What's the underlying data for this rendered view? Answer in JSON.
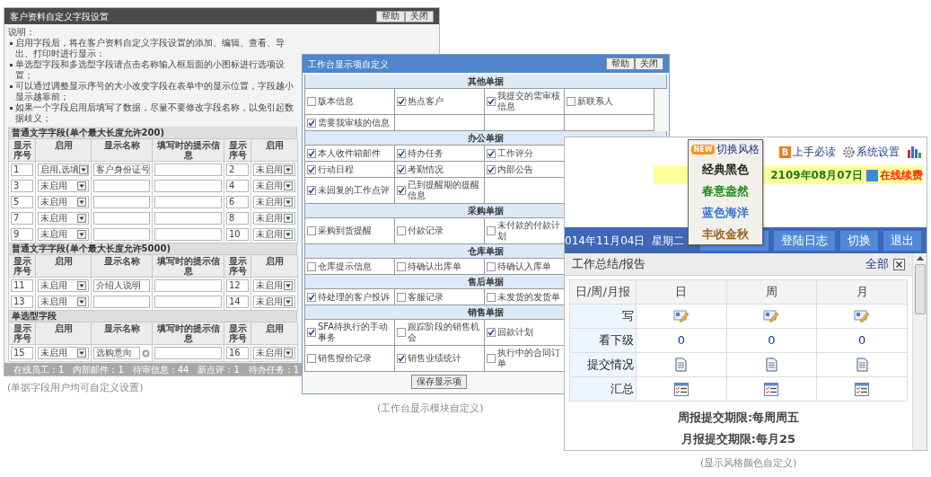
{
  "field_settings_window": {
    "title": "客户资料自定义字段设置",
    "buttons": [
      "帮助",
      "关闭"
    ],
    "notes_label": "说明：",
    "notes": [
      "启用字段后，将在客户资料自定义字段设置的添加、编辑、查看、导出、打印时进行显示：",
      "单选型字段和多选型字段请点击名称输入框后面的小图标进行选项设置；",
      "可以通过调整显示序号的大小改变字段在表单中的显示位置，字段越小显示越靠前；",
      "如果一个字段启用后填写了数据，尽量不要修改字段名称，以免引起数据歧义；"
    ],
    "sections": [
      {
        "title": "普通文字字段(单个最大长度允许200)",
        "columns": [
          "显示序号",
          "启用",
          "显示名称",
          "填写时的提示信息",
          "显示序号",
          "启用"
        ],
        "rows": [
          [
            {
              "kind": "number",
              "value": "1"
            },
            {
              "kind": "select",
              "value": "启用,选填"
            },
            {
              "kind": "text",
              "value": "客户身份证号"
            },
            {
              "kind": "text"
            },
            {
              "kind": "number",
              "value": "2"
            },
            {
              "kind": "select",
              "value": "未启用"
            }
          ],
          [
            {
              "kind": "number",
              "value": "3"
            },
            {
              "kind": "select",
              "value": "未启用"
            },
            {
              "kind": "text"
            },
            {
              "kind": "text"
            },
            {
              "kind": "number",
              "value": "4"
            },
            {
              "kind": "select",
              "value": "未启用"
            }
          ],
          [
            {
              "kind": "number",
              "value": "5"
            },
            {
              "kind": "select",
              "value": "未启用"
            },
            {
              "kind": "text"
            },
            {
              "kind": "text"
            },
            {
              "kind": "number",
              "value": "6"
            },
            {
              "kind": "select",
              "value": "未启用"
            }
          ],
          [
            {
              "kind": "number",
              "value": "7"
            },
            {
              "kind": "select",
              "value": "未启用"
            },
            {
              "kind": "text"
            },
            {
              "kind": "text"
            },
            {
              "kind": "number",
              "value": "8"
            },
            {
              "kind": "select",
              "value": "未启用"
            }
          ],
          [
            {
              "kind": "number",
              "value": "9"
            },
            {
              "kind": "select",
              "value": "未启用"
            },
            {
              "kind": "text"
            },
            {
              "kind": "text"
            },
            {
              "kind": "number",
              "value": "10"
            },
            {
              "kind": "select",
              "value": "未启用"
            }
          ]
        ]
      },
      {
        "title": "普通文字字段(单个最大长度允许5000)",
        "columns": [
          "显示序号",
          "启用",
          "显示名称",
          "填写时的提示信息",
          "显示序号",
          "启用"
        ],
        "rows": [
          [
            {
              "kind": "number",
              "value": "11"
            },
            {
              "kind": "select",
              "value": "未启用"
            },
            {
              "kind": "text",
              "value": "介绍人说明"
            },
            {
              "kind": "text"
            },
            {
              "kind": "number",
              "value": "12"
            },
            {
              "kind": "select",
              "value": "未启用"
            }
          ],
          [
            {
              "kind": "number",
              "value": "13"
            },
            {
              "kind": "select",
              "value": "未启用"
            },
            {
              "kind": "text"
            },
            {
              "kind": "text"
            },
            {
              "kind": "number",
              "value": "14"
            },
            {
              "kind": "select",
              "value": "未启用"
            }
          ]
        ]
      },
      {
        "title": "单选型字段",
        "columns": [
          "显示序号",
          "启用",
          "显示名称",
          "填写时的提示信息",
          "显示序号",
          "启用"
        ],
        "rows": [
          [
            {
              "kind": "number",
              "value": "15"
            },
            {
              "kind": "select",
              "value": "未启用"
            },
            {
              "kind": "options",
              "value": "选购意向"
            },
            {
              "kind": "text"
            },
            {
              "kind": "number",
              "value": "16"
            },
            {
              "kind": "select",
              "value": "未启用"
            }
          ]
        ]
      }
    ],
    "status_bar": [
      "在线员工：1",
      "内部邮件：1",
      "待审信息：44",
      "新点评：1",
      "待办任务：1"
    ],
    "caption": "(单据字段用户均可自定义设置)"
  },
  "workbench_window": {
    "title": "工作台显示项自定义",
    "buttons": [
      "帮助",
      "关闭"
    ],
    "groups": [
      {
        "title": "其他单据",
        "rows": [
          [
            {
              "label": "版本信息",
              "checked": false
            },
            {
              "label": "热点客户",
              "checked": true
            },
            {
              "label": "我提交的需审核信息",
              "checked": true
            },
            {
              "label": "新联系人",
              "checked": false
            }
          ],
          [
            {
              "label": "需要我审核的信息",
              "checked": true
            }
          ]
        ]
      },
      {
        "title": "办公单据",
        "rows": [
          [
            {
              "label": "本人收件箱邮件",
              "checked": true
            },
            {
              "label": "待办任务",
              "checked": true
            },
            {
              "label": "工作评分",
              "checked": true
            }
          ],
          [
            {
              "label": "行动日程",
              "checked": true
            },
            {
              "label": "考勤情况",
              "checked": true
            },
            {
              "label": "内部公告",
              "checked": true
            }
          ],
          [
            {
              "label": "未回复的工作点评",
              "checked": true
            },
            {
              "label": "已到提醒期的提醒信息",
              "checked": true
            }
          ]
        ]
      },
      {
        "title": "采购单据",
        "rows": [
          [
            {
              "label": "采购到货提醒",
              "checked": false
            },
            {
              "label": "付款记录",
              "checked": false
            },
            {
              "label": "未付款的付款计划",
              "checked": false
            }
          ]
        ]
      },
      {
        "title": "仓库单据",
        "rows": [
          [
            {
              "label": "仓库提示信息",
              "checked": false
            },
            {
              "label": "待确认出库单",
              "checked": false
            },
            {
              "label": "待确认入库单",
              "checked": false
            }
          ]
        ]
      },
      {
        "title": "售后单据",
        "rows": [
          [
            {
              "label": "待处理的客户投诉",
              "checked": true
            },
            {
              "label": "客服记录",
              "checked": false
            },
            {
              "label": "未发货的发货单",
              "checked": false
            }
          ]
        ]
      },
      {
        "title": "销售单据",
        "rows": [
          [
            {
              "label": "SFA待执行的手动事务",
              "checked": true
            },
            {
              "label": "跟踪阶段的销售机会",
              "checked": false
            },
            {
              "label": "回款计划",
              "checked": true
            }
          ],
          [
            {
              "label": "销售报价记录",
              "checked": false
            },
            {
              "label": "销售业绩统计",
              "checked": true
            },
            {
              "label": "执行中的合同订单",
              "checked": false
            }
          ]
        ]
      }
    ],
    "save_button": "保存显示项",
    "caption": "(工作台显示模块自定义)"
  },
  "workspace_window": {
    "nav_links": [
      {
        "kind": "guide",
        "badge": "B",
        "label": "上手必读"
      },
      {
        "kind": "settings",
        "label": "系统设置"
      },
      {
        "kind": "chart"
      }
    ],
    "style_menu": {
      "badge": "NEW",
      "label": "切换风格",
      "items": [
        {
          "label": "经典黑色",
          "color": "#222222"
        },
        {
          "label": "春意盎然",
          "color": "#1e8a1e"
        },
        {
          "label": "蓝色海洋",
          "color": "#3b6fd6"
        },
        {
          "label": "丰收金秋",
          "color": "#9a6420"
        }
      ]
    },
    "expiry": "2109年08月07日",
    "renew_link": "在线续费",
    "date_bar": {
      "date": "014年11月04日",
      "weekday": "星期二",
      "buttons": [
        "登陆日志",
        "切换",
        "退出"
      ]
    },
    "report_panel": {
      "title": "工作总结/报告",
      "all_link": "全部",
      "columns": [
        "日/周/月报",
        "日",
        "周",
        "月"
      ],
      "rows": [
        {
          "label": "写",
          "kind": "write"
        },
        {
          "label": "看下级",
          "kind": "count",
          "values": [
            "0",
            "0",
            "0"
          ]
        },
        {
          "label": "提交情况",
          "kind": "submitted"
        },
        {
          "label": "汇总",
          "kind": "summary"
        }
      ],
      "deadlines": [
        "周报提交期限:每周周五",
        "月报提交期限:每月25"
      ]
    },
    "caption": "(显示风格颜色自定义)"
  }
}
